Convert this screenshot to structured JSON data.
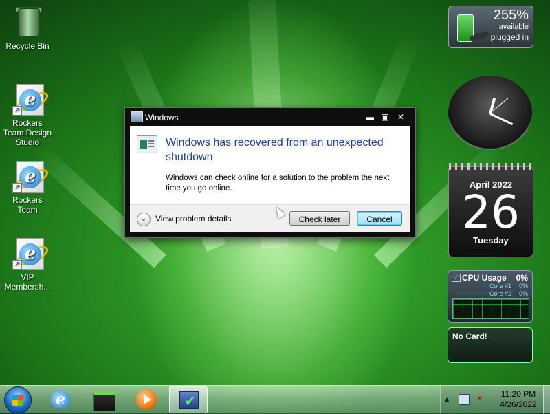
{
  "desktop": {
    "icons": [
      {
        "label": "Recycle Bin"
      },
      {
        "label": "Rockers Team Design Studio"
      },
      {
        "label": "Rockers Team"
      },
      {
        "label": "VIP Membersh..."
      }
    ]
  },
  "gadgets": {
    "battery": {
      "percent": "255%",
      "status_line1": "available",
      "status_line2": "plugged in"
    },
    "calendar": {
      "month_year": "April 2022",
      "day": "26",
      "weekday": "Tuesday"
    },
    "cpu": {
      "title": "CPU Usage",
      "total": "0%",
      "core1_label": "Core #1",
      "core1_value": "0%",
      "core2_label": "Core #2",
      "core2_value": "0%"
    },
    "gpu": {
      "text": "No Card!"
    }
  },
  "dialog": {
    "title": "Windows",
    "heading": "Windows has recovered from an unexpected shutdown",
    "message": "Windows can check online for a solution to the problem the next time you go online.",
    "details_label": "View problem details",
    "check_later_label": "Check later",
    "cancel_label": "Cancel",
    "minimize_glyph": "▬",
    "maximize_glyph": "▣",
    "close_glyph": "✕",
    "toggle_glyph": "⌄"
  },
  "taskbar": {
    "items": [
      "internet-explorer",
      "windows-explorer",
      "media-player",
      "action-center"
    ],
    "tray": {
      "up_arrow": "▲",
      "time": "11:20 PM",
      "date": "4/26/2022"
    }
  }
}
